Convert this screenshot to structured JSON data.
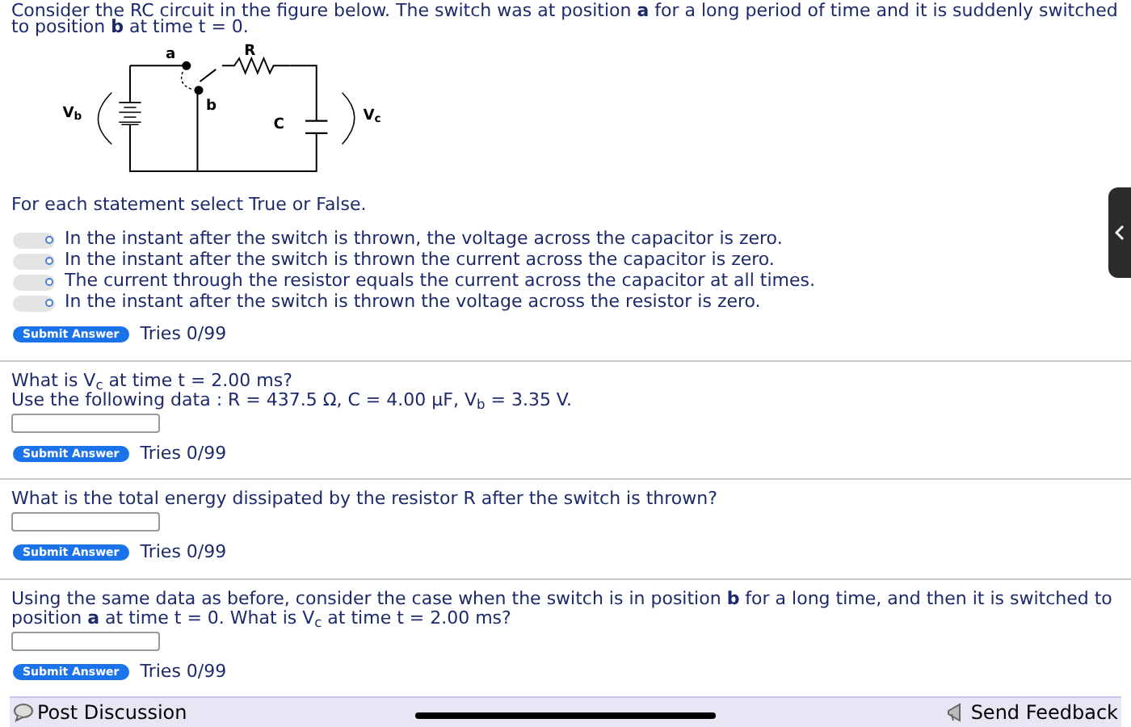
{
  "intro": "Consider the RC circuit in the figure below. The switch was at position **a** for a long period of time and it is suddenly switched to position **b** at time t = 0.",
  "figure": {
    "labels": {
      "a": "a",
      "b": "b",
      "R": "R",
      "C": "C",
      "Vb": "V$_{b}$",
      "Vc": "V$_{c}$"
    }
  },
  "questions": [
    {
      "kind": "statements",
      "prompt": "For each statement select True or False.",
      "statements": [
        {
          "text": "In the instant after the switch is thrown, the voltage across the capacitor is zero."
        },
        {
          "text": "In the instant after the switch is thrown the current across the capacitor is zero."
        },
        {
          "text": "The current through the resistor equals the current across the capacitor at all times."
        },
        {
          "text": "In the instant after the switch is thrown the voltage across the resistor is zero."
        }
      ],
      "submit": "Submit Answer",
      "tries": "Tries 0/99"
    },
    {
      "kind": "numeric",
      "lines": [
        "What is V$_{c}$ at time t = 2.00 ms?",
        "Use the following data : R = 437.5 Ω, C = 4.00 µF, V$_{b}$ = 3.35 V."
      ],
      "submit": "Submit Answer",
      "tries": "Tries 0/99"
    },
    {
      "kind": "numeric",
      "lines": [
        "What is the total energy dissipated by the resistor R after the switch is thrown?"
      ],
      "submit": "Submit Answer",
      "tries": "Tries 0/99"
    },
    {
      "kind": "numeric",
      "lines": [
        "Using the same data as before, consider the case when the switch is in position **b** for a long time, and then it is switched to position **a** at time t = 0. What is V$_{c}$ at time t = 2.00 ms?"
      ],
      "submit": "Submit Answer",
      "tries": "Tries 0/99"
    }
  ],
  "footer": {
    "post": "Post Discussion",
    "feedback": "Send Feedback"
  }
}
